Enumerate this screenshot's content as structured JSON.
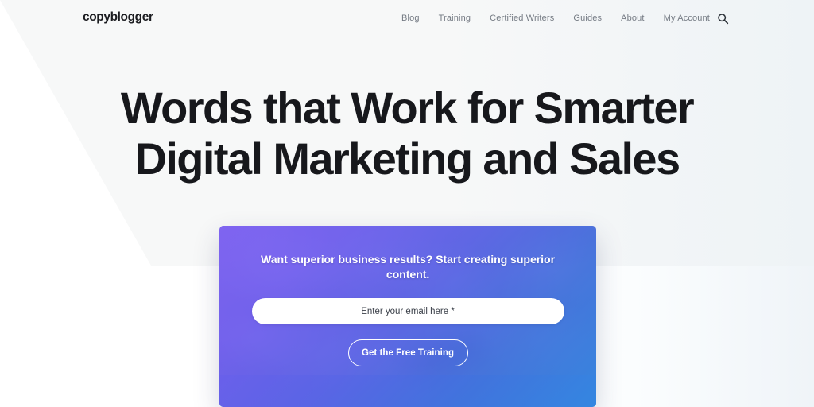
{
  "header": {
    "logo": "copyblogger",
    "nav": [
      {
        "label": "Blog"
      },
      {
        "label": "Training"
      },
      {
        "label": "Certified Writers"
      },
      {
        "label": "Guides"
      },
      {
        "label": "About"
      },
      {
        "label": "My Account"
      }
    ],
    "search_icon": "search-icon"
  },
  "hero": {
    "headline_line1": "Words that Work for Smarter",
    "headline_line2": "Digital Marketing and Sales"
  },
  "cta": {
    "heading": "Want superior business results? Start creating superior content.",
    "email_placeholder": "Enter your email here *",
    "email_value": "",
    "button_label": "Get the Free Training"
  },
  "colors": {
    "page_background": "#ffffff",
    "band_background": "#f7f8f8",
    "headline_text": "#17181c",
    "nav_text": "#757b84",
    "cta_gradient_start": "#7c5cf6",
    "cta_gradient_end": "#2e86e4",
    "cta_text": "#ffffff",
    "input_background": "#ffffff",
    "input_text": "#3b4049"
  }
}
